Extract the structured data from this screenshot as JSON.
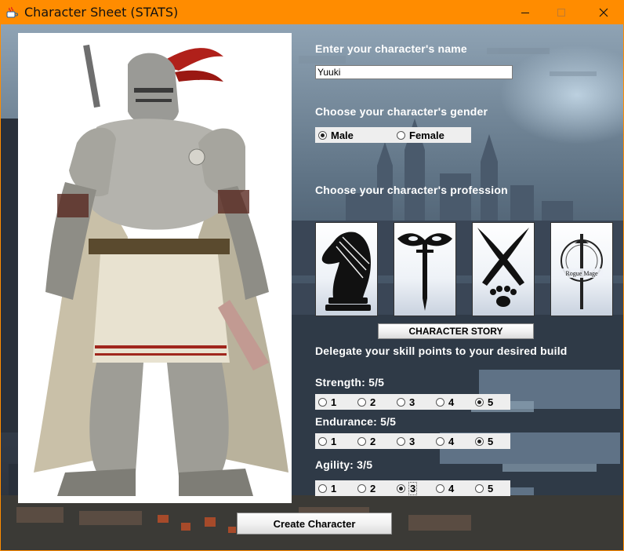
{
  "window": {
    "title": "Character Sheet (STATS)",
    "accent_color": "#ff8c00",
    "icons": [
      "java-app-icon",
      "minimize-icon",
      "maximize-icon",
      "close-icon"
    ]
  },
  "name_section": {
    "prompt": "Enter your character's name",
    "value": "Yuuki"
  },
  "gender_section": {
    "prompt": "Choose your character's gender",
    "options": [
      {
        "label": "Male",
        "selected": true
      },
      {
        "label": "Female",
        "selected": false
      }
    ]
  },
  "profession_section": {
    "prompt": "Choose your character's profession",
    "professions": [
      {
        "icon": "chess-knight-icon"
      },
      {
        "icon": "masked-sword-icon"
      },
      {
        "icon": "crossed-blades-paw-icon"
      },
      {
        "icon": "rogue-mage-emblem-icon",
        "emblem_text": "Rogue Mage"
      }
    ],
    "story_button": "CHARACTER STORY"
  },
  "skills_section": {
    "prompt": "Delegate your skill points to your desired build",
    "stats": [
      {
        "label": "Strength: 5/5",
        "options": [
          "1",
          "2",
          "3",
          "4",
          "5"
        ],
        "selected": "5"
      },
      {
        "label": "Endurance: 5/5",
        "options": [
          "1",
          "2",
          "3",
          "4",
          "5"
        ],
        "selected": "5"
      },
      {
        "label": "Agility: 3/5",
        "options": [
          "1",
          "2",
          "3",
          "4",
          "5"
        ],
        "selected": "3"
      }
    ]
  },
  "create_button": "Create Character"
}
